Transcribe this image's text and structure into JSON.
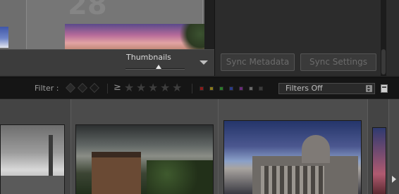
{
  "grid": {
    "cell_number": "28"
  },
  "toolbar": {
    "thumbnails_label": "Thumbnails",
    "thumbnail_size_fraction": 0.56
  },
  "sync": {
    "metadata_label": "Sync Metadata",
    "settings_label": "Sync Settings"
  },
  "filter": {
    "label": "Filter :",
    "rating_operator": "≥",
    "stars": [
      "★",
      "★",
      "★",
      "★",
      "★"
    ],
    "select_value": "Filters Off",
    "color_labels": [
      "#8b1a1a",
      "#8a7a1a",
      "#2a7a2a",
      "#2a3a8a",
      "#6a2a7a",
      "#6a6a6a",
      "#3a3a3a"
    ]
  }
}
